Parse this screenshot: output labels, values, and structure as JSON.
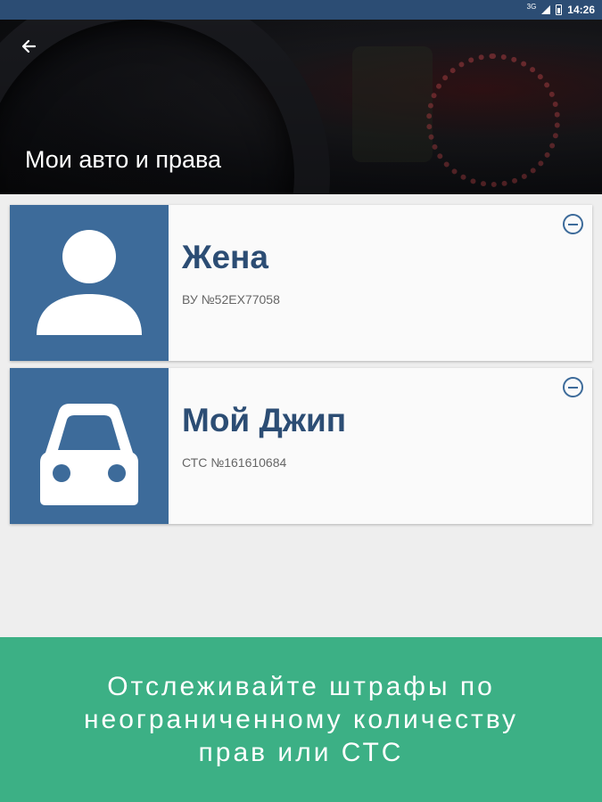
{
  "status_bar": {
    "network": "3G",
    "time": "14:26"
  },
  "header": {
    "title": "Мои авто и права",
    "back_icon": "arrow-left-icon"
  },
  "cards": [
    {
      "name": "Жена",
      "doc": "ВУ №52ЕХ77058",
      "icon": "person-icon"
    },
    {
      "name": "Мой Джип",
      "doc": "СТС №161610684",
      "icon": "car-icon"
    }
  ],
  "banner": {
    "lines": [
      "Отслеживайте штрафы по",
      "неограниченному количеству",
      "прав или СТС"
    ]
  },
  "colors": {
    "primary": "#2c4d74",
    "tile": "#3d6b9a",
    "accent": "#3cb085"
  }
}
